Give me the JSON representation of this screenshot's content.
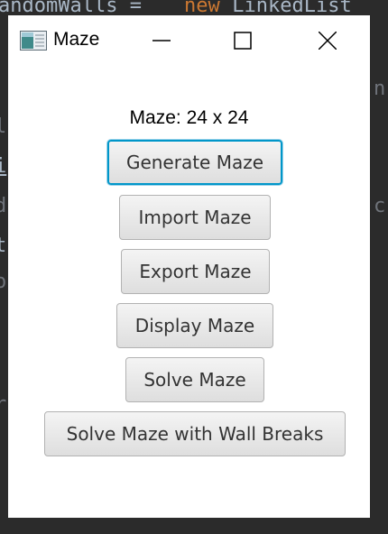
{
  "editor": {
    "line1_a": "andomWalls = ",
    "line1_kw": "new",
    "line1_b": " LinkedList",
    "right_char_1": "n",
    "right_char_2": "c",
    "left_fragments": [
      "l",
      "i",
      "d",
      "t",
      "o",
      "r"
    ]
  },
  "window": {
    "title": "Maze",
    "icon": "maze-app-icon"
  },
  "status": {
    "maze_size": "Maze: 24 x 24"
  },
  "buttons": {
    "generate": "Generate Maze",
    "import": "Import Maze",
    "export": "Export Maze",
    "display": "Display Maze",
    "solve": "Solve Maze",
    "solve_breaks": "Solve Maze with Wall Breaks"
  },
  "colors": {
    "focus_border": "#0096c9",
    "editor_background": "#2b2b2b",
    "keyword": "#cc7832"
  }
}
